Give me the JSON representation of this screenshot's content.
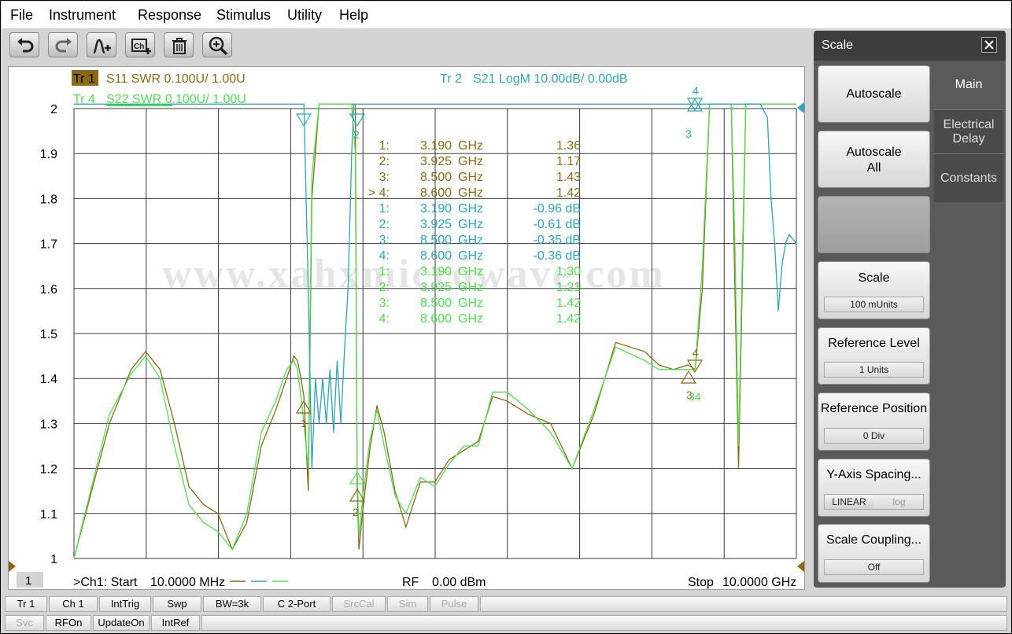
{
  "menu": [
    "File",
    "Instrument",
    "Response",
    "Stimulus",
    "Utility",
    "Help"
  ],
  "toolbar_icons": [
    "undo-icon",
    "redo-icon",
    "add-marker-icon",
    "add-channel-icon",
    "delete-icon",
    "zoom-icon"
  ],
  "traces": {
    "tr1": {
      "id": "Tr 1",
      "label": "S11 SWR 0.100U/  1.00U",
      "color": "#8b6914"
    },
    "tr2": {
      "id": "Tr  2",
      "label": "S21 LogM 10.00dB/  0.00dB",
      "color": "#2aa6b4"
    },
    "tr4": {
      "id": "Tr  4",
      "label": "S22 SWR 0.100U/  1.00U",
      "color": "#4fe04f"
    }
  },
  "watermark": "www.xahxmicrowave.com",
  "markers": [
    {
      "n": "1:",
      "freq": "3.190",
      "unit": "GHz",
      "value": "1.36",
      "trace": "tr1"
    },
    {
      "n": "2:",
      "freq": "3.925",
      "unit": "GHz",
      "value": "1.17",
      "trace": "tr1"
    },
    {
      "n": "3:",
      "freq": "8.500",
      "unit": "GHz",
      "value": "1.43",
      "trace": "tr1"
    },
    {
      "n": "> 4:",
      "freq": "8.600",
      "unit": "GHz",
      "value": "1.42",
      "trace": "tr1"
    },
    {
      "n": "1:",
      "freq": "3.190",
      "unit": "GHz",
      "value": "-0.96 dB",
      "trace": "tr2"
    },
    {
      "n": "2:",
      "freq": "3.925",
      "unit": "GHz",
      "value": "-0.61 dB",
      "trace": "tr2"
    },
    {
      "n": "3:",
      "freq": "8.500",
      "unit": "GHz",
      "value": "-0.35 dB",
      "trace": "tr2"
    },
    {
      "n": "4:",
      "freq": "8.600",
      "unit": "GHz",
      "value": "-0.36 dB",
      "trace": "tr2"
    },
    {
      "n": "1:",
      "freq": "3.190",
      "unit": "GHz",
      "value": "1.30",
      "trace": "tr4"
    },
    {
      "n": "2:",
      "freq": "3.925",
      "unit": "GHz",
      "value": "1.21",
      "trace": "tr4"
    },
    {
      "n": "3:",
      "freq": "8.500",
      "unit": "GHz",
      "value": "1.42",
      "trace": "tr4"
    },
    {
      "n": "4:",
      "freq": "8.600",
      "unit": "GHz",
      "value": "1.42",
      "trace": "tr4"
    }
  ],
  "chart_data": {
    "type": "line",
    "x_start_ghz": 0.01,
    "x_stop_ghz": 10.0,
    "ylim": [
      1.0,
      2.0
    ],
    "yticks": [
      "2",
      "1.9",
      "1.8",
      "1.7",
      "1.6",
      "1.5",
      "1.4",
      "1.3",
      "1.2",
      "1.1",
      "1"
    ],
    "grid": true,
    "series": [
      {
        "name": "S11 SWR",
        "color": "#8b6914",
        "x": [
          0.01,
          0.5,
          0.8,
          1.0,
          1.2,
          1.4,
          1.6,
          1.8,
          2.0,
          2.2,
          2.4,
          2.6,
          2.8,
          2.95,
          3.05,
          3.1,
          3.15,
          3.19,
          3.25,
          3.3,
          3.4,
          3.5,
          3.6,
          3.7,
          3.8,
          3.85,
          3.9,
          3.925,
          3.95,
          4.0,
          4.1,
          4.2,
          4.3,
          4.45,
          4.6,
          4.8,
          5.0,
          5.2,
          5.4,
          5.6,
          5.8,
          6.0,
          6.3,
          6.6,
          6.9,
          7.2,
          7.5,
          7.9,
          8.1,
          8.3,
          8.5,
          8.6,
          8.7,
          8.8,
          8.9,
          9.0,
          9.1,
          9.15,
          9.2,
          9.25,
          9.3,
          9.4,
          9.6,
          9.8,
          10.0
        ],
        "y": [
          1.0,
          1.3,
          1.42,
          1.46,
          1.42,
          1.3,
          1.16,
          1.12,
          1.1,
          1.02,
          1.08,
          1.25,
          1.33,
          1.4,
          1.45,
          1.44,
          1.4,
          1.36,
          1.15,
          1.8,
          2.01,
          2.01,
          2.01,
          2.01,
          2.01,
          2.01,
          2.01,
          1.17,
          1.02,
          1.1,
          1.24,
          1.34,
          1.28,
          1.15,
          1.07,
          1.17,
          1.17,
          1.22,
          1.24,
          1.26,
          1.36,
          1.35,
          1.32,
          1.3,
          1.2,
          1.32,
          1.48,
          1.46,
          1.43,
          1.42,
          1.43,
          1.42,
          1.6,
          2.01,
          2.01,
          2.01,
          2.01,
          1.6,
          1.2,
          1.6,
          2.01,
          2.01,
          2.01,
          2.01,
          2.01
        ]
      },
      {
        "name": "S22 SWR",
        "color": "#4fe04f",
        "x": [
          0.01,
          0.5,
          0.8,
          1.0,
          1.2,
          1.4,
          1.6,
          1.8,
          2.0,
          2.2,
          2.4,
          2.6,
          2.8,
          2.95,
          3.05,
          3.1,
          3.15,
          3.19,
          3.25,
          3.3,
          3.4,
          3.5,
          3.6,
          3.7,
          3.8,
          3.85,
          3.9,
          3.925,
          3.95,
          4.0,
          4.1,
          4.2,
          4.3,
          4.45,
          4.6,
          4.8,
          5.0,
          5.2,
          5.4,
          5.6,
          5.8,
          6.0,
          6.3,
          6.6,
          6.9,
          7.2,
          7.5,
          7.9,
          8.1,
          8.3,
          8.5,
          8.6,
          8.7,
          8.8,
          8.9,
          9.0,
          9.1,
          9.15,
          9.2,
          9.25,
          9.3,
          9.4,
          9.6,
          9.8,
          10.0
        ],
        "y": [
          1.0,
          1.32,
          1.41,
          1.45,
          1.4,
          1.25,
          1.12,
          1.08,
          1.06,
          1.02,
          1.1,
          1.28,
          1.35,
          1.42,
          1.44,
          1.42,
          1.36,
          1.3,
          1.2,
          1.85,
          2.01,
          2.01,
          2.01,
          2.01,
          2.01,
          2.01,
          1.9,
          1.21,
          1.05,
          1.13,
          1.26,
          1.33,
          1.25,
          1.14,
          1.1,
          1.18,
          1.16,
          1.21,
          1.25,
          1.25,
          1.37,
          1.37,
          1.33,
          1.28,
          1.2,
          1.33,
          1.47,
          1.44,
          1.42,
          1.42,
          1.42,
          1.42,
          1.65,
          2.01,
          2.01,
          2.01,
          2.01,
          1.7,
          1.25,
          1.65,
          2.01,
          2.01,
          2.01,
          2.01,
          2.01
        ]
      },
      {
        "name": "S21 LogM",
        "color": "#2aa6b4",
        "x": [
          0.01,
          1.0,
          2.0,
          3.0,
          3.1,
          3.15,
          3.19,
          3.22,
          3.25,
          3.3,
          3.35,
          3.4,
          3.45,
          3.5,
          3.55,
          3.6,
          3.65,
          3.7,
          3.75,
          3.8,
          3.85,
          3.88,
          3.9,
          3.925,
          4.0,
          5.0,
          6.0,
          7.0,
          8.0,
          8.5,
          8.6,
          9.0,
          9.4,
          9.5,
          9.6,
          9.65,
          9.7,
          9.75,
          9.8,
          9.85,
          9.9,
          9.95,
          10.0
        ],
        "y": [
          2.01,
          2.01,
          2.01,
          2.01,
          2.01,
          2.01,
          2.01,
          1.8,
          1.6,
          1.2,
          1.4,
          1.3,
          1.4,
          1.3,
          1.42,
          1.28,
          1.44,
          1.3,
          1.46,
          1.6,
          1.9,
          2.01,
          2.01,
          2.01,
          2.01,
          2.01,
          2.01,
          2.01,
          2.01,
          2.01,
          2.01,
          2.01,
          2.01,
          2.01,
          1.98,
          1.8,
          1.7,
          1.55,
          1.65,
          1.7,
          1.72,
          1.71,
          1.7
        ]
      }
    ]
  },
  "footer": {
    "channel_num": "1",
    "start_label": ">Ch1:  Start",
    "start_value": "10.0000 MHz",
    "rf_label": "RF",
    "rf_value": "0.00 dBm",
    "stop_label": "Stop",
    "stop_value": "10.0000 GHz"
  },
  "panel": {
    "title": "Scale",
    "buttons": {
      "autoscale": "Autoscale",
      "autoscale_all_1": "Autoscale",
      "autoscale_all_2": "All",
      "scale": "Scale",
      "scale_value": "100 mUnits",
      "ref_level": "Reference Level",
      "ref_level_value": "1 Units",
      "ref_pos": "Reference Position",
      "ref_pos_value": "0 Div",
      "yaxis": "Y-Axis Spacing...",
      "yaxis_linear": "LINEAR",
      "yaxis_log": "log",
      "coupling": "Scale Coupling...",
      "coupling_value": "Off"
    },
    "tabs": {
      "main": "Main",
      "electrical_1": "Electrical",
      "electrical_2": "Delay",
      "constants": "Constants"
    }
  },
  "status_row1": [
    "Tr 1",
    "Ch 1",
    "IntTrig",
    "Swp",
    "BW=3k",
    "C  2-Port",
    "SrcCal",
    "Sim",
    "Pulse"
  ],
  "status_row2": [
    "Svc",
    "RFOn",
    "UpdateOn",
    "IntRef"
  ]
}
